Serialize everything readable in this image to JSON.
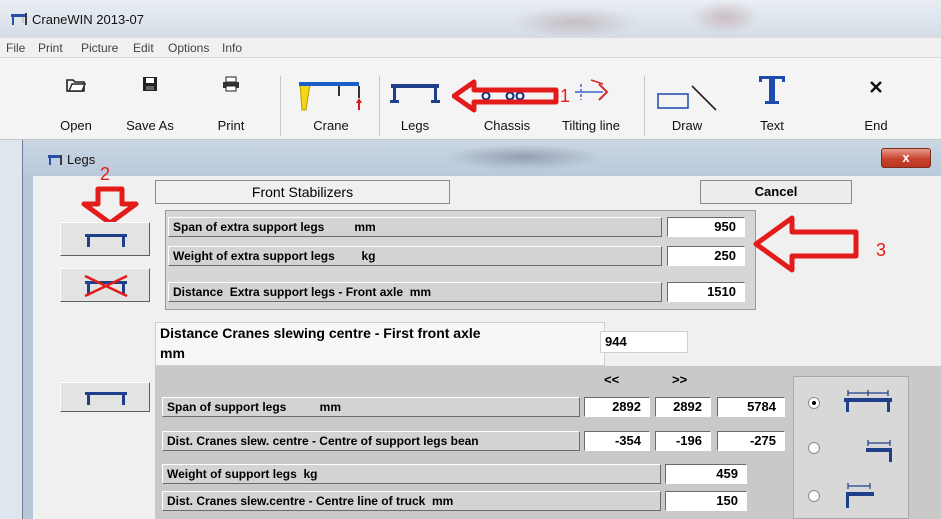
{
  "window": {
    "title": "CraneWIN 2013-07"
  },
  "menu": [
    "File",
    "Print",
    "Picture",
    "Edit",
    "Options",
    "Info"
  ],
  "toolbar": [
    {
      "label": "Open",
      "icon": "open-folder-icon"
    },
    {
      "label": "Save As",
      "icon": "floppy-disk-icon"
    },
    {
      "label": "Print",
      "icon": "printer-icon"
    },
    {
      "label": "Crane",
      "icon": "crane-icon"
    },
    {
      "label": "Legs",
      "icon": "legs-icon"
    },
    {
      "label": "Chassis",
      "icon": "chassis-icon"
    },
    {
      "label": "Tilting line",
      "icon": "tilting-line-icon"
    },
    {
      "label": "Draw",
      "icon": "draw-icon"
    },
    {
      "label": "Text",
      "icon": "text-icon"
    },
    {
      "label": "End",
      "icon": "close-x-icon"
    }
  ],
  "annotations": {
    "one": "1",
    "two": "2",
    "three": "3",
    "color": "#e31b1b"
  },
  "dialog": {
    "title": "Legs",
    "close_label": "x",
    "tab_label": "Front Stabilizers",
    "cancel_label": "Cancel",
    "extra_legs": [
      {
        "label": "Span of extra support legs         mm",
        "value": "950"
      },
      {
        "label": "Weight of extra support legs        kg",
        "value": "250"
      },
      {
        "label": "Distance  Extra support legs - Front axle  mm",
        "value": "1510"
      }
    ],
    "slewing": {
      "label_line1": "Distance  Cranes slewing centre - First front axle",
      "label_line2": "mm",
      "value": "944"
    },
    "support": {
      "col_left": "<<",
      "col_right": ">>",
      "span": {
        "label": "Span of support legs          mm",
        "values": [
          "2892",
          "2892",
          "5784"
        ]
      },
      "dist_beam": {
        "label": "Dist. Cranes slew. centre - Centre of support legs bean",
        "values": [
          "-354",
          "-196",
          "-275"
        ]
      },
      "weight": {
        "label": "Weight of support legs  kg",
        "value": "459"
      },
      "dist_truck": {
        "label": "Dist. Cranes slew.centre - Centre line of truck  mm",
        "value": "150"
      }
    },
    "radios": [
      true,
      false,
      false
    ]
  }
}
